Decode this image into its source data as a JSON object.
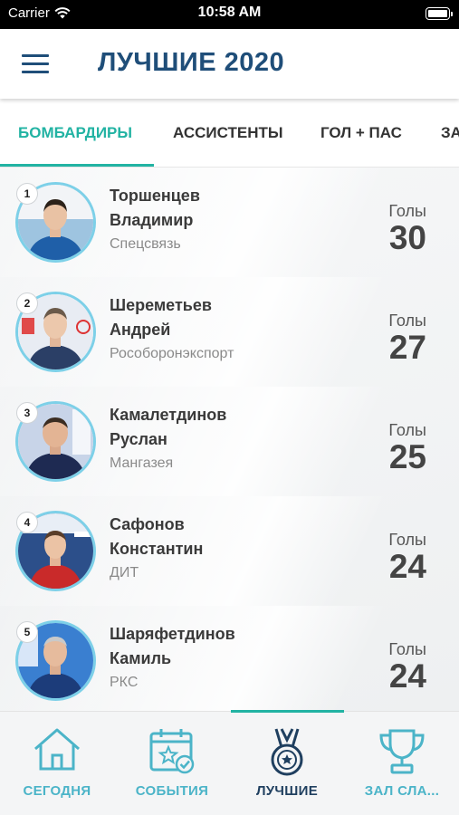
{
  "status_bar": {
    "carrier": "Carrier",
    "time": "10:58 AM"
  },
  "header": {
    "title": "ЛУЧШИЕ 2020"
  },
  "tabs": [
    {
      "label": "БОМБАРДИРЫ",
      "active": true
    },
    {
      "label": "АССИСТЕНТЫ",
      "active": false
    },
    {
      "label": "ГОЛ + ПАС",
      "active": false
    },
    {
      "label": "ЗА",
      "active": false
    }
  ],
  "players": [
    {
      "rank": "1",
      "first_line": "Торшенцев",
      "second_line": "Владимир",
      "team": "Спецсвязь",
      "stat_label": "Голы",
      "stat_value": "30",
      "shirt": "#1f5fa8",
      "backdrop": "#9ec4e0"
    },
    {
      "rank": "2",
      "first_line": "Шереметьев",
      "second_line": "Андрей",
      "team": "Рособоронэкспорт",
      "stat_label": "Голы",
      "stat_value": "27",
      "shirt": "#2b3f66",
      "backdrop": "#e04a4a"
    },
    {
      "rank": "3",
      "first_line": "Камалетдинов",
      "second_line": "Руслан",
      "team": "Мангазея",
      "stat_label": "Голы",
      "stat_value": "25",
      "shirt": "#1e2a52",
      "backdrop": "#c8d4e8"
    },
    {
      "rank": "4",
      "first_line": "Сафонов",
      "second_line": "Константин",
      "team": "ДИТ",
      "stat_label": "Голы",
      "stat_value": "24",
      "shirt": "#c92a2a",
      "backdrop": "#2c4f8a"
    },
    {
      "rank": "5",
      "first_line": "Шаряфетдинов",
      "second_line": "Камиль",
      "team": "РКС",
      "stat_label": "Голы",
      "stat_value": "24",
      "shirt": "#1c3c7a",
      "backdrop": "#3a7fd0"
    }
  ],
  "bottom_nav": [
    {
      "label": "СЕГОДНЯ",
      "icon": "home-icon",
      "active": false
    },
    {
      "label": "СОБЫТИЯ",
      "icon": "calendar-star-icon",
      "active": false
    },
    {
      "label": "ЛУЧШИЕ",
      "icon": "medal-icon",
      "active": true
    },
    {
      "label": "ЗАЛ СЛА...",
      "icon": "trophy-icon",
      "active": false
    }
  ],
  "colors": {
    "accent": "#22b3a3",
    "title": "#1f4e79",
    "nav_icon": "#4bb4c8",
    "avatar_ring": "#7dd0e8"
  }
}
